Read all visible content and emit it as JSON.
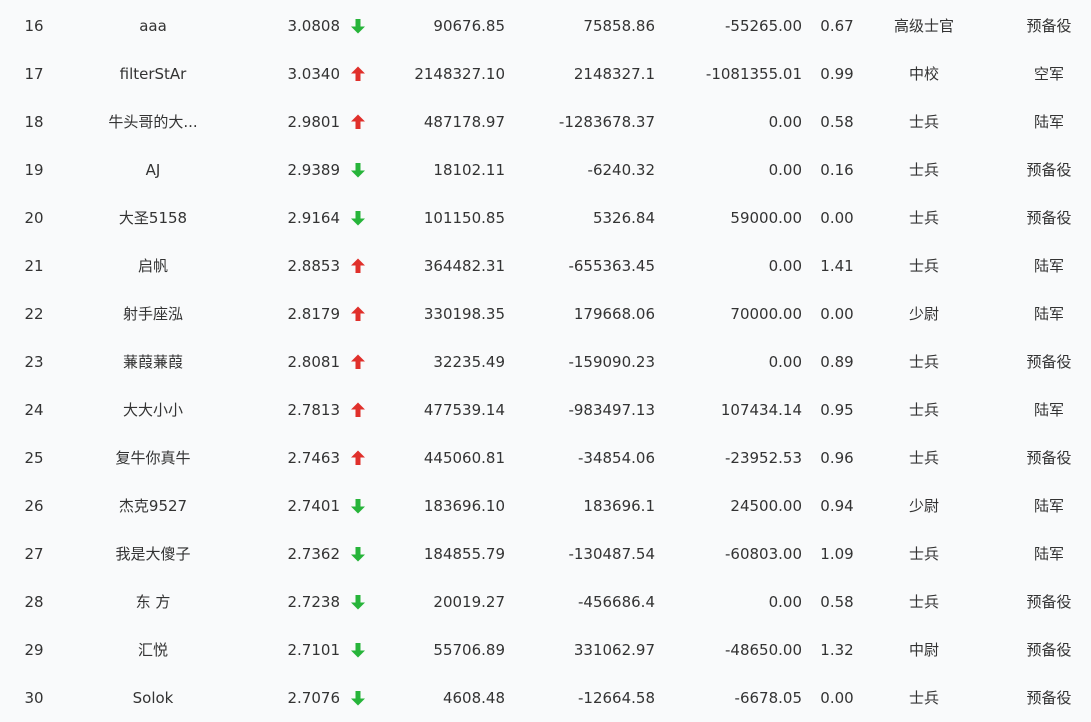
{
  "colors": {
    "up": "#e0302b",
    "down": "#27b43a",
    "text": "#333333",
    "background": "#f9fafb"
  },
  "rows": [
    {
      "rank": "16",
      "name": "aaa",
      "score": "3.0808",
      "trend": "down",
      "v1": "90676.85",
      "v2": "75858.86",
      "v3": "-55265.00",
      "ratio": "0.67",
      "rank_title": "高级士官",
      "branch": "预备役"
    },
    {
      "rank": "17",
      "name": "filterStAr",
      "score": "3.0340",
      "trend": "up",
      "v1": "2148327.10",
      "v2": "2148327.1",
      "v3": "-1081355.01",
      "ratio": "0.99",
      "rank_title": "中校",
      "branch": "空军"
    },
    {
      "rank": "18",
      "name": "牛头哥的大...",
      "score": "2.9801",
      "trend": "up",
      "v1": "487178.97",
      "v2": "-1283678.37",
      "v3": "0.00",
      "ratio": "0.58",
      "rank_title": "士兵",
      "branch": "陆军"
    },
    {
      "rank": "19",
      "name": "AJ",
      "score": "2.9389",
      "trend": "down",
      "v1": "18102.11",
      "v2": "-6240.32",
      "v3": "0.00",
      "ratio": "0.16",
      "rank_title": "士兵",
      "branch": "预备役"
    },
    {
      "rank": "20",
      "name": "大圣5158",
      "score": "2.9164",
      "trend": "down",
      "v1": "101150.85",
      "v2": "5326.84",
      "v3": "59000.00",
      "ratio": "0.00",
      "rank_title": "士兵",
      "branch": "预备役"
    },
    {
      "rank": "21",
      "name": "启帆",
      "score": "2.8853",
      "trend": "up",
      "v1": "364482.31",
      "v2": "-655363.45",
      "v3": "0.00",
      "ratio": "1.41",
      "rank_title": "士兵",
      "branch": "陆军"
    },
    {
      "rank": "22",
      "name": "射手座泓",
      "score": "2.8179",
      "trend": "up",
      "v1": "330198.35",
      "v2": "179668.06",
      "v3": "70000.00",
      "ratio": "0.00",
      "rank_title": "少尉",
      "branch": "陆军"
    },
    {
      "rank": "23",
      "name": "蒹葭蒹葭",
      "score": "2.8081",
      "trend": "up",
      "v1": "32235.49",
      "v2": "-159090.23",
      "v3": "0.00",
      "ratio": "0.89",
      "rank_title": "士兵",
      "branch": "预备役"
    },
    {
      "rank": "24",
      "name": "大大小小",
      "score": "2.7813",
      "trend": "up",
      "v1": "477539.14",
      "v2": "-983497.13",
      "v3": "107434.14",
      "ratio": "0.95",
      "rank_title": "士兵",
      "branch": "陆军"
    },
    {
      "rank": "25",
      "name": "复牛你真牛",
      "score": "2.7463",
      "trend": "up",
      "v1": "445060.81",
      "v2": "-34854.06",
      "v3": "-23952.53",
      "ratio": "0.96",
      "rank_title": "士兵",
      "branch": "预备役"
    },
    {
      "rank": "26",
      "name": "杰克9527",
      "score": "2.7401",
      "trend": "down",
      "v1": "183696.10",
      "v2": "183696.1",
      "v3": "24500.00",
      "ratio": "0.94",
      "rank_title": "少尉",
      "branch": "陆军"
    },
    {
      "rank": "27",
      "name": "我是大傻子",
      "score": "2.7362",
      "trend": "down",
      "v1": "184855.79",
      "v2": "-130487.54",
      "v3": "-60803.00",
      "ratio": "1.09",
      "rank_title": "士兵",
      "branch": "陆军"
    },
    {
      "rank": "28",
      "name": "东 方",
      "score": "2.7238",
      "trend": "down",
      "v1": "20019.27",
      "v2": "-456686.4",
      "v3": "0.00",
      "ratio": "0.58",
      "rank_title": "士兵",
      "branch": "预备役"
    },
    {
      "rank": "29",
      "name": "汇悦",
      "score": "2.7101",
      "trend": "down",
      "v1": "55706.89",
      "v2": "331062.97",
      "v3": "-48650.00",
      "ratio": "1.32",
      "rank_title": "中尉",
      "branch": "预备役"
    },
    {
      "rank": "30",
      "name": "Solok",
      "score": "2.7076",
      "trend": "down",
      "v1": "4608.48",
      "v2": "-12664.58",
      "v3": "-6678.05",
      "ratio": "0.00",
      "rank_title": "士兵",
      "branch": "预备役"
    }
  ]
}
